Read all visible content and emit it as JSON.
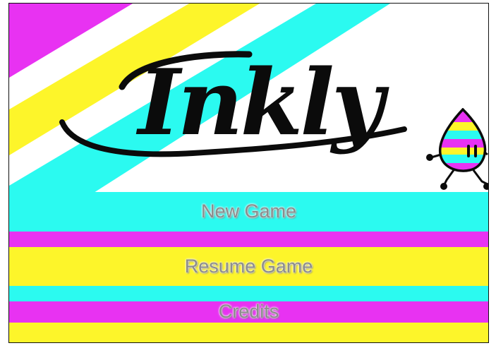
{
  "logo": {
    "text": "Inkly"
  },
  "menu": {
    "new_game": "New Game",
    "resume_game": "Resume Game",
    "credits": "Credits"
  },
  "colors": {
    "magenta": "#e832f2",
    "yellow": "#fdf52a",
    "cyan": "#2bfaf0",
    "ink": "#0b0b0b",
    "menu_text": "#8c8c8c"
  },
  "icons": {
    "mascot": "ink-drop-mascot-icon"
  }
}
